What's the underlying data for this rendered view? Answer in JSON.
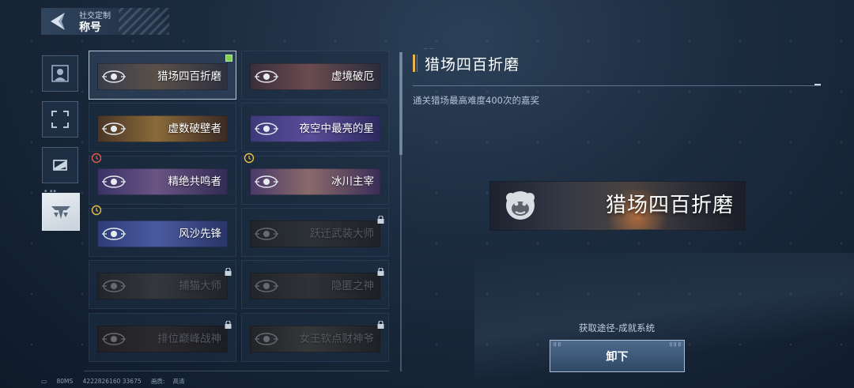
{
  "header": {
    "subtitle": "社交定制",
    "title": "称号",
    "tiny": "........"
  },
  "side_tabs": [
    {
      "name": "avatar-tab",
      "icon": "avatar-icon",
      "active": false
    },
    {
      "name": "frame-tab",
      "icon": "frame-icon",
      "active": false
    },
    {
      "name": "card-tab",
      "icon": "card-icon",
      "active": false
    },
    {
      "name": "title-tab",
      "icon": "title-emblem-icon",
      "active": true
    }
  ],
  "titles": [
    {
      "label": "猎场四百折磨",
      "selected": true,
      "locked": false,
      "timed": false,
      "timer_color": "",
      "bg": [
        "#3a3d4a",
        "#5a5049",
        "#2e3140"
      ]
    },
    {
      "label": "虚境破厄",
      "selected": false,
      "locked": false,
      "timed": false,
      "timer_color": "",
      "bg": [
        "#3b2f3a",
        "#6a4b4e",
        "#2c2d3c"
      ]
    },
    {
      "label": "虚数破壁者",
      "selected": false,
      "locked": false,
      "timed": false,
      "timer_color": "",
      "bg": [
        "#4a3526",
        "#8a6a3a",
        "#3a2a24"
      ]
    },
    {
      "label": "夜空中最亮的星",
      "selected": false,
      "locked": false,
      "timed": false,
      "timer_color": "",
      "bg": [
        "#3b3a7a",
        "#5a4c9a",
        "#2d2a5e"
      ]
    },
    {
      "label": "精绝共鸣者",
      "selected": false,
      "locked": false,
      "timed": true,
      "timer_color": "#e05a4a",
      "bg": [
        "#3a3266",
        "#6a5484",
        "#322c55"
      ]
    },
    {
      "label": "冰川主宰",
      "selected": false,
      "locked": false,
      "timed": true,
      "timer_color": "#e8c04a",
      "bg": [
        "#4a3a6a",
        "#8a6a6a",
        "#3a2e58"
      ]
    },
    {
      "label": "风沙先锋",
      "selected": false,
      "locked": false,
      "timed": true,
      "timer_color": "#e8c04a",
      "bg": [
        "#2e3c78",
        "#4a5aa0",
        "#2a3568"
      ]
    },
    {
      "label": "跃迁武装大师",
      "selected": false,
      "locked": true,
      "timed": false,
      "timer_color": "",
      "bg": [
        "#3a3f4a",
        "#5a6070",
        "#353a46"
      ]
    },
    {
      "label": "捕猫大师",
      "selected": false,
      "locked": true,
      "timed": false,
      "timer_color": "",
      "bg": [
        "#3e4556",
        "#6a7080",
        "#3a4050"
      ]
    },
    {
      "label": "隐匿之神",
      "selected": false,
      "locked": true,
      "timed": false,
      "timer_color": "",
      "bg": [
        "#4a3e3e",
        "#7a5a5a",
        "#3a3238"
      ]
    },
    {
      "label": "排位巅峰战神",
      "selected": false,
      "locked": true,
      "timed": false,
      "timer_color": "",
      "bg": [
        "#6a2e2e",
        "#8a4040",
        "#4a2a30"
      ]
    },
    {
      "label": "女王钦点财神爷",
      "selected": false,
      "locked": true,
      "timed": false,
      "timer_color": "",
      "bg": [
        "#5a3a2e",
        "#8a6a3a",
        "#4a3046"
      ]
    }
  ],
  "detail": {
    "title": "猎场四百折磨",
    "description": "通关猎场最高难度400次的嘉奖",
    "banner_label": "猎场四百折磨",
    "obtain": "获取途径-成就系统",
    "action_label": "卸下",
    "action_mini_left": "|| ||",
    "action_mini_right": "|| || ||",
    "marker": "— —"
  },
  "footer": {
    "ping": "80MS",
    "uid": "4222826160 33675",
    "quality_label": "画质:",
    "quality_value": "高清"
  },
  "colors": {
    "accent": "#e8b54a",
    "selected_dot": "#7fd24f",
    "button": "#3e5a7c"
  }
}
